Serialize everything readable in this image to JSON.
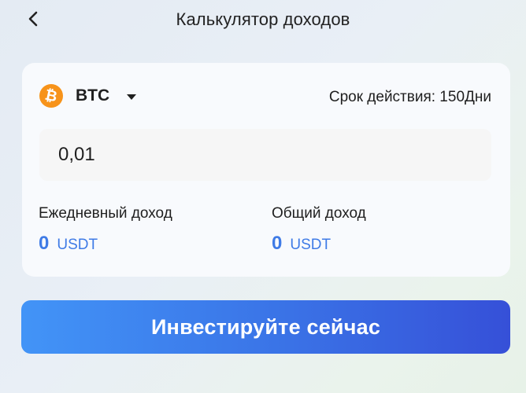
{
  "header": {
    "title": "Калькулятор доходов",
    "back_icon": "chevron-left-icon"
  },
  "calculator": {
    "coin": {
      "icon": "bitcoin-icon",
      "symbol_glyph": "₿",
      "name": "BTC",
      "dropdown_icon": "caret-down-icon",
      "icon_color": "#f7931a"
    },
    "term": "Срок действия: 150Дни",
    "amount": "0,01",
    "daily": {
      "label": "Ежедневный доход",
      "value": "0",
      "unit": "USDT"
    },
    "total": {
      "label": "Общий доход",
      "value": "0",
      "unit": "USDT"
    }
  },
  "actions": {
    "invest_label": "Инвестируйте сейчас"
  },
  "colors": {
    "accent": "#3f7be6",
    "button_gradient_start": "#4294f7",
    "button_gradient_end": "#3650d8"
  }
}
